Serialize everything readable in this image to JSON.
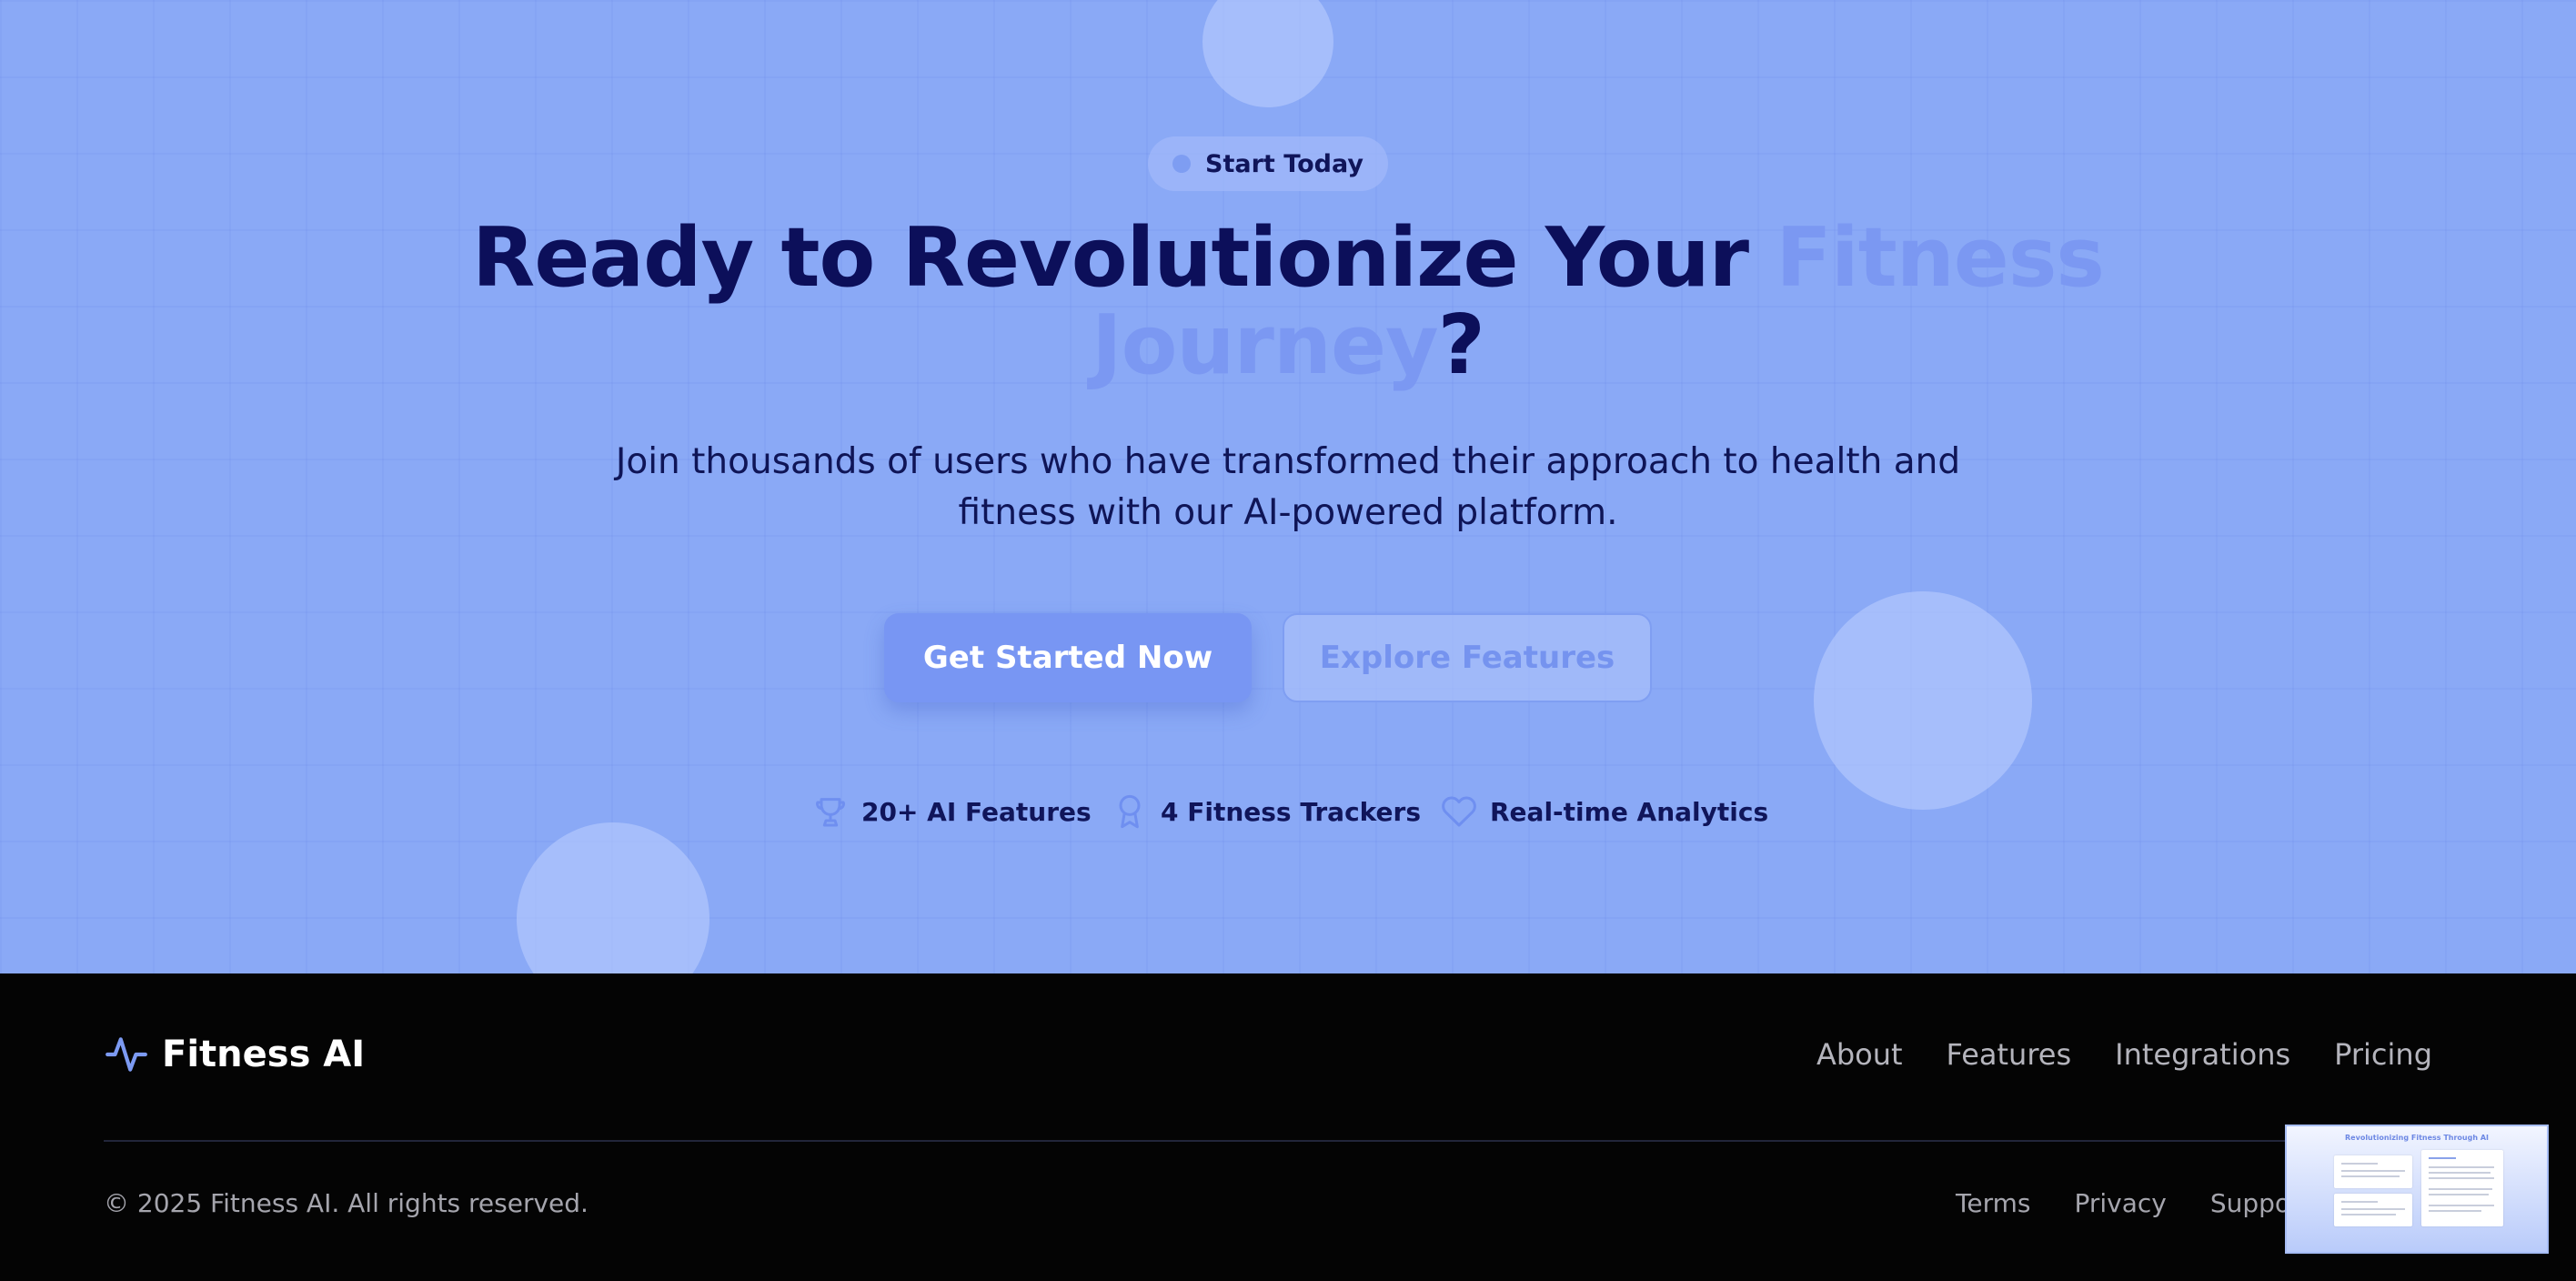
{
  "hero": {
    "badge": "Start Today",
    "headline_prefix": "Ready to Revolutionize Your ",
    "headline_accent": "Fitness Journey",
    "headline_suffix": "?",
    "subheadline": "Join thousands of users who have transformed their approach to health and fitness with our AI-powered platform.",
    "primary_cta": "Get Started Now",
    "secondary_cta": "Explore Features",
    "stats": [
      {
        "icon": "trophy-icon",
        "label": "20+ AI Features"
      },
      {
        "icon": "award-icon",
        "label": "4 Fitness Trackers"
      },
      {
        "icon": "heart-icon",
        "label": "Real-time Analytics"
      }
    ]
  },
  "footer": {
    "brand": "Fitness AI",
    "brand_icon": "activity-icon",
    "nav": [
      "About",
      "Features",
      "Integrations",
      "Pricing"
    ],
    "copyright": "© 2025 Fitness AI. All rights reserved.",
    "legal": [
      "Terms",
      "Privacy",
      "Suppor"
    ]
  },
  "preview_thumbnail": {
    "title": "Revolutionizing Fitness Through AI"
  },
  "colors": {
    "hero_background": "#8aa9f6",
    "headline": "#0c0f5a",
    "accent": "#7b98f2",
    "primary_button": "#7896f3",
    "footer_background": "#040404"
  }
}
